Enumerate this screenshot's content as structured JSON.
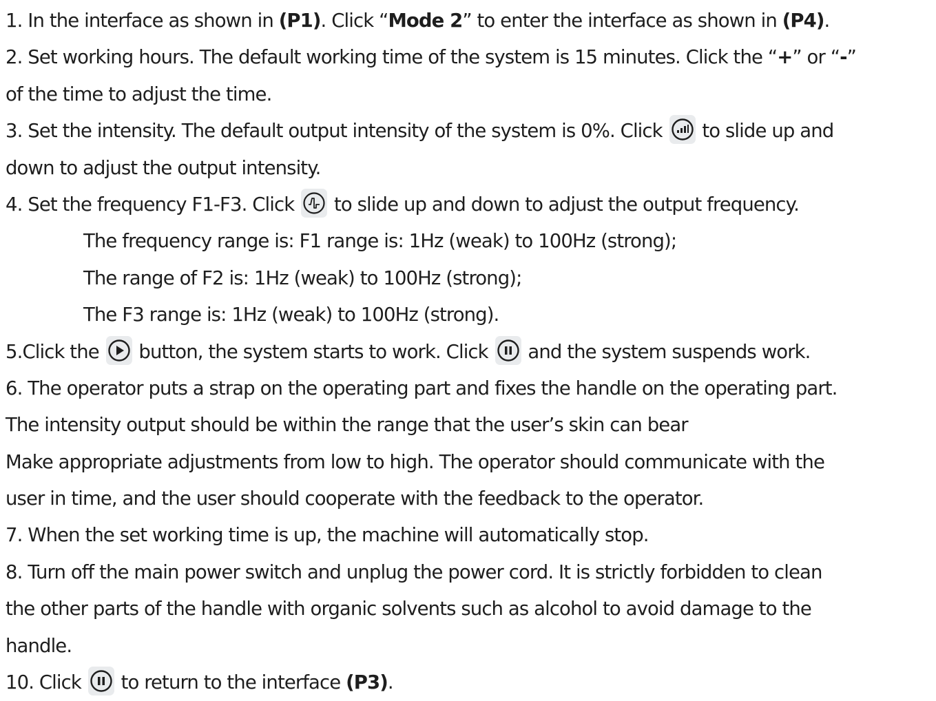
{
  "lines": [
    {
      "a": "1. In the interface as shown in ",
      "b": "(P1)",
      "c": ". Click “",
      "d": "Mode 2",
      "e": "” to enter the interface as shown in ",
      "f": "(P4)",
      "g": "."
    },
    {
      "a": "2. Set working hours. The default working time of the system is 15 minutes. Click the “",
      "b": "+",
      "c": "” or “",
      "d": "-",
      "e": "”"
    },
    {
      "a": "of the time to adjust the time."
    },
    {
      "a": "3. Set the intensity. The default output intensity of the system is 0%. Click ",
      "b": " to slide up and"
    },
    {
      "a": "down to adjust the output intensity."
    },
    {
      "a": "4. Set the frequency F1-F3. Click ",
      "b": " to slide up and down to adjust the output frequency."
    },
    {
      "a": "The frequency range is: F1 range is: 1Hz (weak) to 100Hz (strong);"
    },
    {
      "a": "The range of F2 is: 1Hz (weak) to 100Hz (strong);"
    },
    {
      "a": "The F3 range is: 1Hz (weak) to 100Hz (strong)."
    },
    {
      "a": "5.Click the ",
      "b": " button, the system starts to work. Click ",
      "c": " and the system suspends work."
    },
    {
      "a": "6. The operator puts a strap on the operating part and fixes the handle on the operating part."
    },
    {
      "a": "The intensity output should be within the range that the user’s skin can bear"
    },
    {
      "a": "Make appropriate adjustments from low to high. The operator should communicate with the"
    },
    {
      "a": "user in time, and the user should cooperate with the feedback to the operator."
    },
    {
      "a": "7. When the set working time is up, the machine will automatically stop."
    },
    {
      "a": "8. Turn off the main power switch and unplug the power cord. It is strictly forbidden to clean"
    },
    {
      "a": "the other parts of the handle with organic solvents such as alcohol to avoid damage to the"
    },
    {
      "a": "handle."
    },
    {
      "a": "10. Click ",
      "b": " to return to the interface ",
      "c": "(P3)",
      "d": "."
    }
  ],
  "icons": {
    "intensity": "intensity-bars-icon",
    "frequency": "frequency-wave-icon",
    "play": "play-icon",
    "pause": "pause-icon"
  }
}
